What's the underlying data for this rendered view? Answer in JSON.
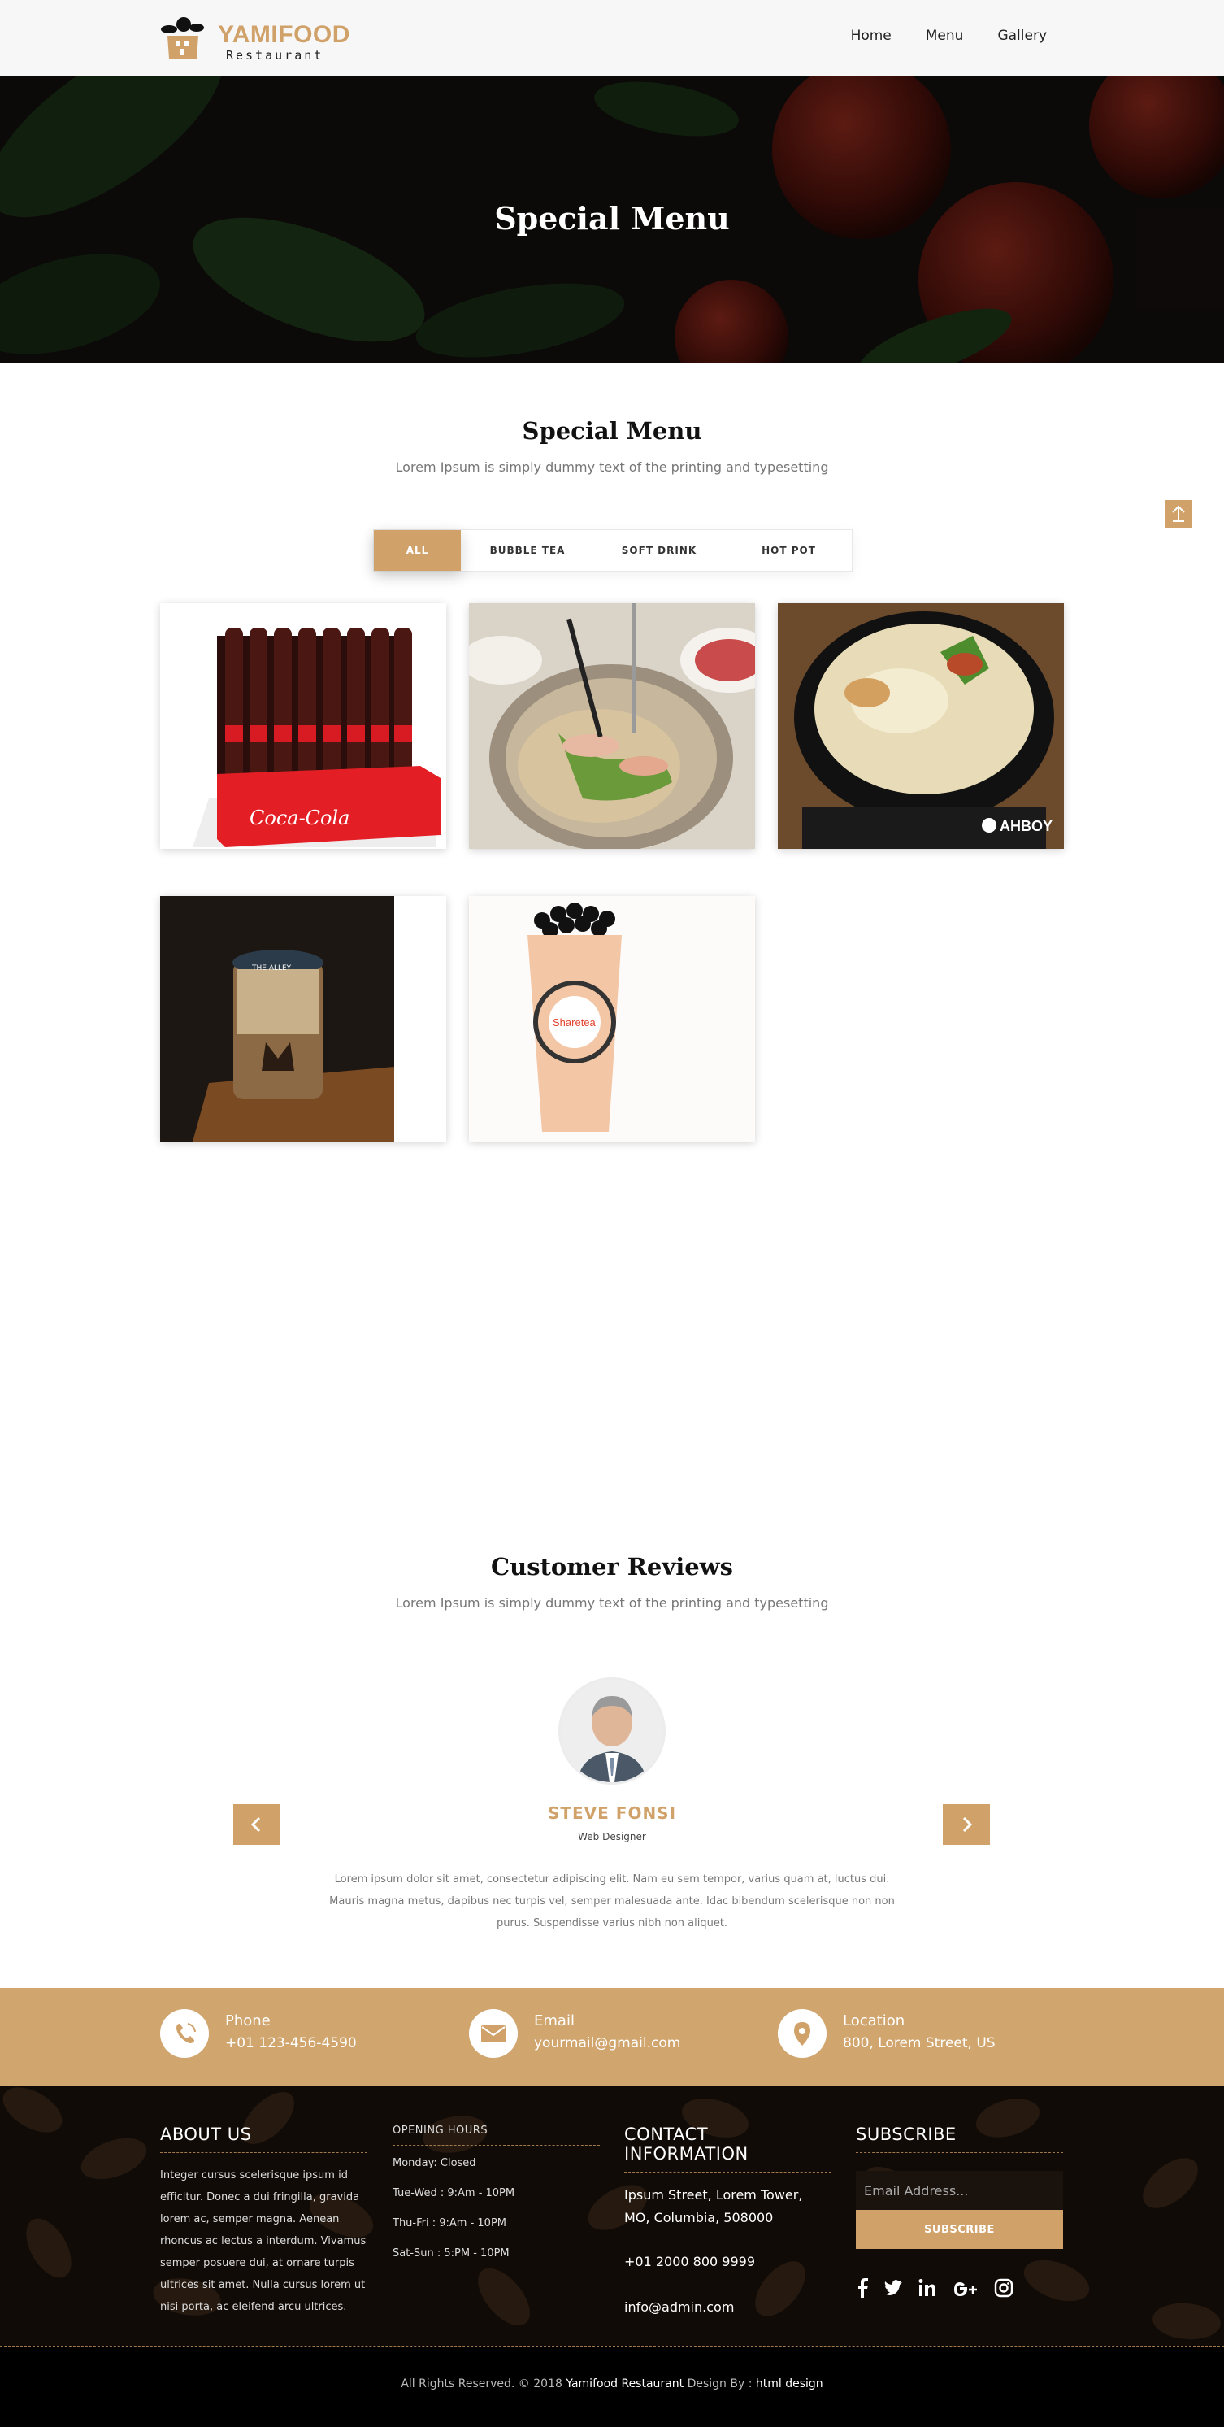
{
  "brand": {
    "name": "YAMIFOOD",
    "tagline": "Restaurant",
    "accent": "#d0a26a"
  },
  "nav": {
    "items": [
      "Home",
      "Menu",
      "Gallery"
    ]
  },
  "hero": {
    "title": "Special Menu"
  },
  "menu_section": {
    "title": "Special Menu",
    "subtitle": "Lorem Ipsum is simply dummy text of the printing and typesetting",
    "filters": [
      "ALL",
      "BUBBLE TEA",
      "SOFT DRINK",
      "HOT POT"
    ],
    "active_filter": "ALL",
    "items": [
      {
        "image": "coca-cola-crate",
        "label": "Coca-Cola"
      },
      {
        "image": "hot-pot-table",
        "label": ""
      },
      {
        "image": "hot-pot-bowl",
        "label": "AHBOY"
      },
      {
        "image": "bubble-tea-cup",
        "label": "THE ALLEY"
      },
      {
        "image": "sharetea-cup",
        "label": "Sharetea"
      }
    ]
  },
  "reviews": {
    "title": "Customer Reviews",
    "subtitle": "Lorem Ipsum is simply dummy text of the printing and typesetting",
    "name": "STEVE FONSI",
    "role": "Web Designer",
    "text": "Lorem ipsum dolor sit amet, consectetur adipiscing elit. Nam eu sem tempor, varius quam at, luctus dui. Mauris magna metus, dapibus nec turpis vel, semper malesuada ante. Idac bibendum scelerisque non non purus. Suspendisse varius nibh non aliquet."
  },
  "contact_strip": {
    "phone": {
      "title": "Phone",
      "value": "+01 123-456-4590",
      "icon": "phone-icon"
    },
    "email": {
      "title": "Email",
      "value": "yourmail@gmail.com",
      "icon": "envelope-icon"
    },
    "location": {
      "title": "Location",
      "value": "800, Lorem Street, US",
      "icon": "map-pin-icon"
    }
  },
  "footer": {
    "about": {
      "title": "ABOUT US",
      "text": "Integer cursus scelerisque ipsum id efficitur. Donec a dui fringilla, gravida lorem ac, semper magna. Aenean rhoncus ac lectus a interdum. Vivamus semper posuere dui, at ornare turpis ultrices sit amet. Nulla cursus lorem ut nisi porta, ac eleifend arcu ultrices."
    },
    "hours": {
      "title": "OPENING HOURS",
      "lines": [
        "Monday: Closed",
        "Tue-Wed : 9:Am - 10PM",
        "Thu-Fri : 9:Am - 10PM",
        "Sat-Sun : 5:PM - 10PM"
      ]
    },
    "contact": {
      "title": "CONTACT INFORMATION",
      "address": "Ipsum Street, Lorem Tower, MO, Columbia, 508000",
      "phone": "+01 2000 800 9999",
      "email": "info@admin.com"
    },
    "subscribe": {
      "title": "SUBSCRIBE",
      "placeholder": "Email Address...",
      "button": "SUBSCRIBE",
      "socials": [
        "f",
        "twitter",
        "in",
        "G+",
        "instagram"
      ]
    }
  },
  "copyright": {
    "prefix": "All Rights Reserved. © 2018 ",
    "brand": "Yamifood Restaurant",
    "middle": " Design By : ",
    "designer": "html design"
  }
}
